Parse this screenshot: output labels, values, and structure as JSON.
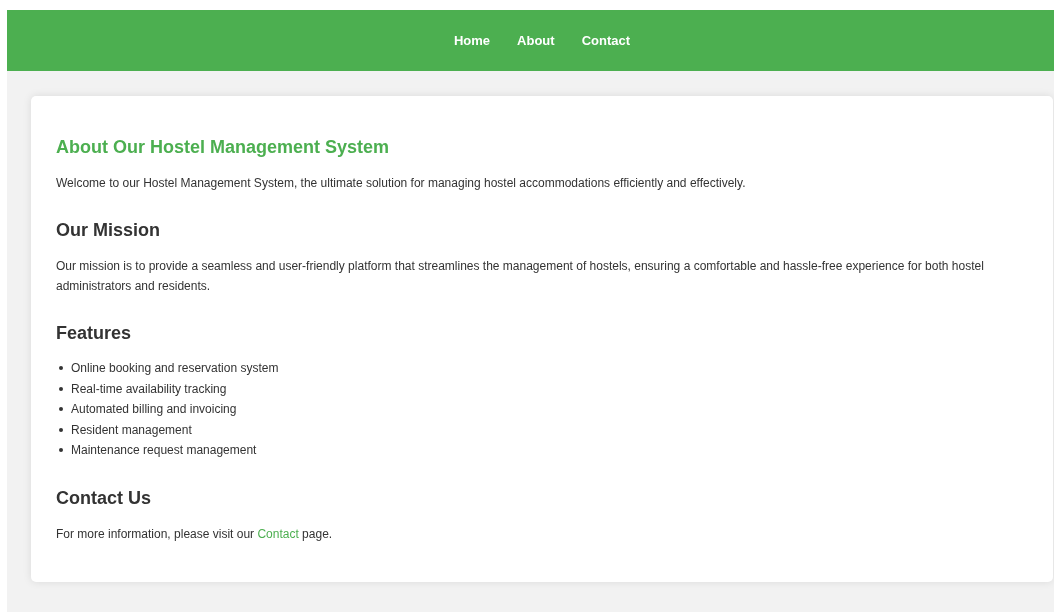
{
  "nav": [
    {
      "label": "Home"
    },
    {
      "label": "About"
    },
    {
      "label": "Contact"
    }
  ],
  "about": {
    "title": "About Our Hostel Management System",
    "intro": "Welcome to our Hostel Management System, the ultimate solution for managing hostel accommodations efficiently and effectively."
  },
  "sections": [
    {
      "kind": "text",
      "heading": "Our Mission",
      "text": "Our mission is to provide a seamless and user-friendly platform that streamlines the management of hostels, ensuring a comfortable and hassle-free experience for both hostel administrators and residents."
    },
    {
      "kind": "list",
      "heading": "Features",
      "items": [
        "Online booking and reservation system",
        "Real-time availability tracking",
        "Automated billing and invoicing",
        "Resident management",
        "Maintenance request management"
      ]
    },
    {
      "kind": "link_text",
      "heading": "Contact Us",
      "before": "For more information, please visit our ",
      "link": "Contact",
      "after": " page."
    }
  ]
}
